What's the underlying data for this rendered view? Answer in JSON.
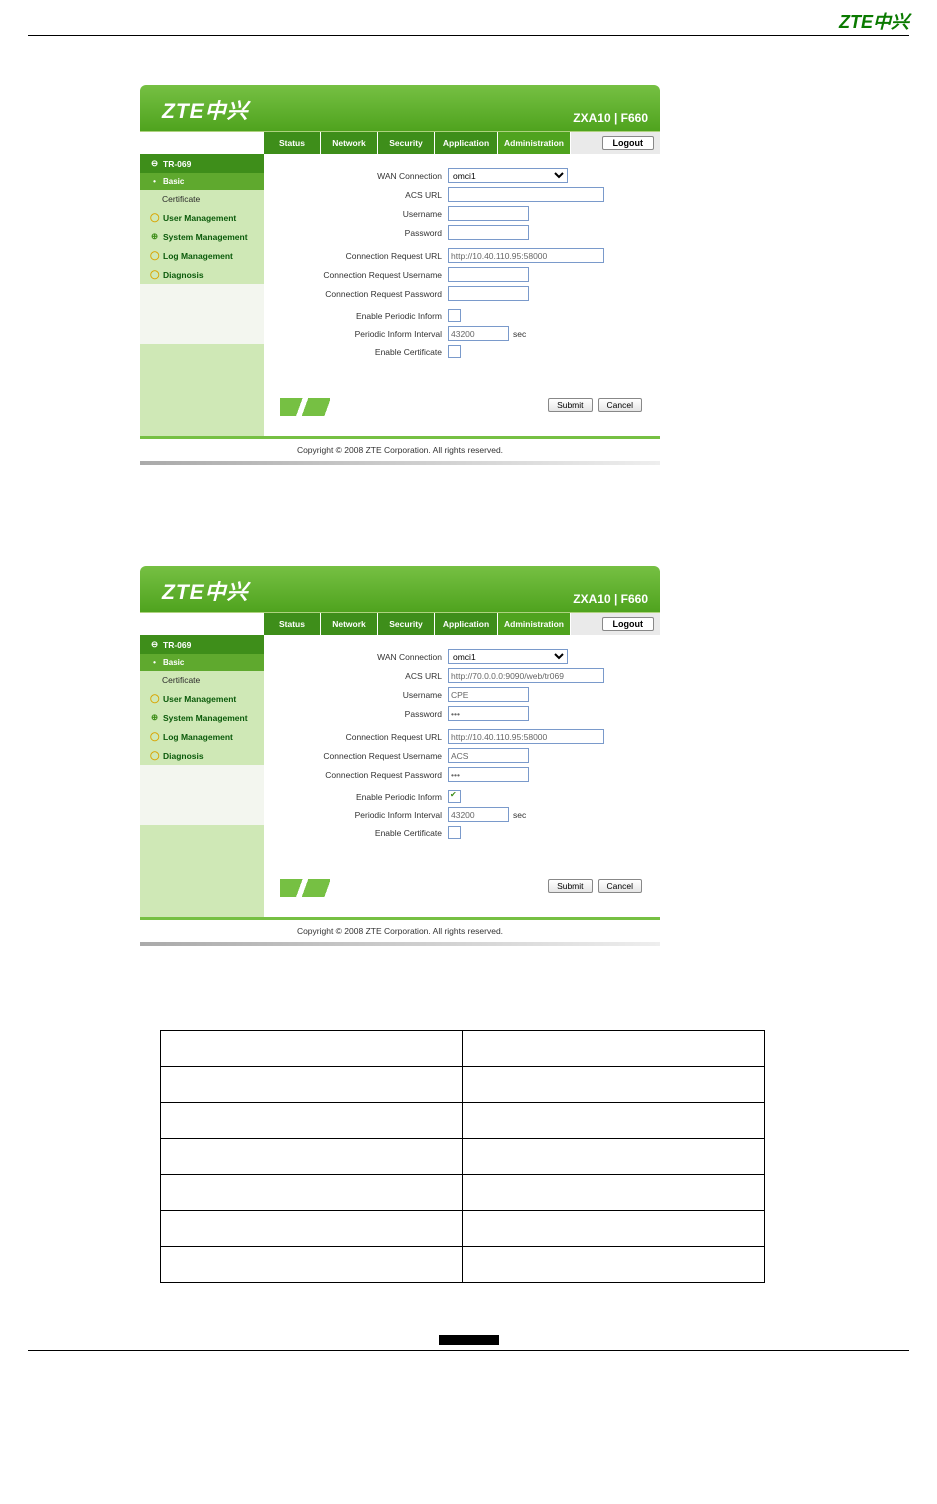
{
  "doc_logo": "ZTE中兴",
  "header": {
    "logo": "ZTE中兴",
    "model": "ZXA10 | F660"
  },
  "nav": {
    "tabs": [
      "Status",
      "Network",
      "Security",
      "Application",
      "Administration"
    ],
    "logout": "Logout"
  },
  "sidebar": {
    "tr069": "TR-069",
    "basic": "Basic",
    "cert": "Certificate",
    "user_mgmt": "User Management",
    "sys_mgmt": "System Management",
    "log_mgmt": "Log Management",
    "diagnosis": "Diagnosis"
  },
  "labels": {
    "wan_conn": "WAN Connection",
    "acs_url": "ACS URL",
    "username": "Username",
    "password": "Password",
    "conn_req_url": "Connection Request URL",
    "conn_req_user": "Connection Request Username",
    "conn_req_pass": "Connection Request Password",
    "enable_periodic": "Enable Periodic Inform",
    "periodic_interval": "Periodic Inform Interval",
    "enable_cert": "Enable Certificate",
    "sec": "sec"
  },
  "frame1_values": {
    "wan_conn": "omci1",
    "acs_url": "",
    "username": "",
    "password": "",
    "conn_req_url": "http://10.40.110.95:58000",
    "conn_req_user": "",
    "conn_req_pass": "",
    "periodic_checked": false,
    "periodic_interval": "43200",
    "cert_checked": false
  },
  "frame2_values": {
    "wan_conn": "omci1",
    "acs_url": "http://70.0.0.0:9090/web/tr069",
    "username": "CPE",
    "password": "•••",
    "conn_req_url": "http://10.40.110.95:58000",
    "conn_req_user": "ACS",
    "conn_req_pass": "•••",
    "periodic_checked": true,
    "periodic_interval": "43200",
    "cert_checked": false
  },
  "buttons": {
    "submit": "Submit",
    "cancel": "Cancel"
  },
  "copyright": "Copyright © 2008 ZTE Corporation. All rights reserved.",
  "param_table": {
    "header": [
      "",
      ""
    ],
    "rows": [
      [
        "",
        ""
      ],
      [
        "",
        ""
      ],
      [
        "",
        ""
      ],
      [
        "",
        ""
      ],
      [
        "",
        ""
      ],
      [
        "",
        ""
      ]
    ]
  },
  "page_number": ""
}
